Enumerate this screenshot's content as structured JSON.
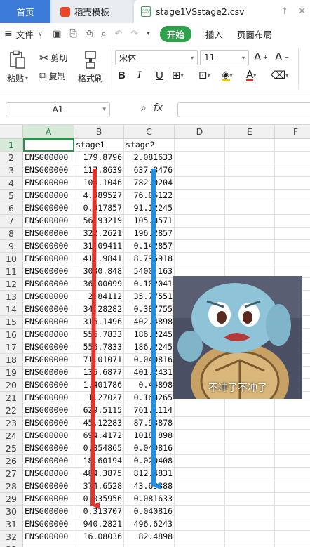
{
  "tabs": [
    {
      "label": "首页"
    },
    {
      "label": "稻壳模板"
    },
    {
      "label": "stage1VSstage2.csv"
    }
  ],
  "menubar": {
    "file_menu": "文件",
    "start": "开始",
    "insert": "插入",
    "page_layout": "页面布局"
  },
  "ribbon": {
    "paste": "粘贴",
    "cut": "剪切",
    "copy": "复制",
    "format_painter": "格式刷",
    "font_name": "宋体",
    "font_size": "11",
    "bold": "B",
    "italic": "I",
    "underline": "U"
  },
  "formula_bar": {
    "name_box": "A1",
    "fx": "fx"
  },
  "grid": {
    "columns": [
      "A",
      "B",
      "C",
      "D",
      "E",
      "F"
    ],
    "rows": [
      {
        "num": "1",
        "a": "",
        "b": "stage1",
        "c": "stage2"
      },
      {
        "num": "2",
        "a": "ENSG00000",
        "b": "179.8796",
        "c": "2.081633"
      },
      {
        "num": "3",
        "a": "ENSG00000",
        "b": "117.8639",
        "c": "637.8476"
      },
      {
        "num": "4",
        "a": "ENSG00000",
        "b": "103.1046",
        "c": "782.0204"
      },
      {
        "num": "5",
        "a": "ENSG00000",
        "b": "4.089527",
        "c": "76.06122"
      },
      {
        "num": "6",
        "a": "ENSG00000",
        "b": "0.017857",
        "c": "91.12245"
      },
      {
        "num": "7",
        "a": "ENSG00000",
        "b": "56.93219",
        "c": "105.8571"
      },
      {
        "num": "8",
        "a": "ENSG00000",
        "b": "322.2621",
        "c": "196.2857"
      },
      {
        "num": "9",
        "a": "ENSG00000",
        "b": "31.09411",
        "c": "0.142857"
      },
      {
        "num": "10",
        "a": "ENSG00000",
        "b": "411.9841",
        "c": "8.795918"
      },
      {
        "num": "11",
        "a": "ENSG00000",
        "b": "3030.848",
        "c": "5400.163"
      },
      {
        "num": "12",
        "a": "ENSG00000",
        "b": "36.00099",
        "c": "0.102041"
      },
      {
        "num": "13",
        "a": "ENSG00000",
        "b": "2.84112",
        "c": "35.77551"
      },
      {
        "num": "14",
        "a": "ENSG00000",
        "b": "34.28282",
        "c": "0.387755"
      },
      {
        "num": "15",
        "a": "ENSG00000",
        "b": "316.1496",
        "c": "402.4898"
      },
      {
        "num": "16",
        "a": "ENSG00000",
        "b": "556.7833",
        "c": "186.2245"
      },
      {
        "num": "17",
        "a": "ENSG00000",
        "b": "556.7833",
        "c": "186.2245"
      },
      {
        "num": "18",
        "a": "ENSG00000",
        "b": "71.01071",
        "c": "0.040816"
      },
      {
        "num": "19",
        "a": "ENSG00000",
        "b": "135.6877",
        "c": "401.2431"
      },
      {
        "num": "20",
        "a": "ENSG00000",
        "b": "1.401786",
        "c": "0.44898"
      },
      {
        "num": "21",
        "a": "ENSG00000",
        "b": "1.27027",
        "c": "0.163265"
      },
      {
        "num": "22",
        "a": "ENSG00000",
        "b": "629.5115",
        "c": "761.1114"
      },
      {
        "num": "23",
        "a": "ENSG00000",
        "b": "45.12283",
        "c": "87.93878"
      },
      {
        "num": "24",
        "a": "ENSG00000",
        "b": "694.4172",
        "c": "1018.898"
      },
      {
        "num": "25",
        "a": "ENSG00000",
        "b": "0.354865",
        "c": "0.040816"
      },
      {
        "num": "26",
        "a": "ENSG00000",
        "b": "18.60194",
        "c": "0.020408"
      },
      {
        "num": "27",
        "a": "ENSG00000",
        "b": "484.3875",
        "c": "812.4831"
      },
      {
        "num": "28",
        "a": "ENSG00000",
        "b": "374.6528",
        "c": "43.69388"
      },
      {
        "num": "29",
        "a": "ENSG00000",
        "b": "0.035956",
        "c": "0.081633"
      },
      {
        "num": "30",
        "a": "ENSG00000",
        "b": "0.313707",
        "c": "0.040816"
      },
      {
        "num": "31",
        "a": "ENSG00000",
        "b": "940.2821",
        "c": "496.6243"
      },
      {
        "num": "32",
        "a": "ENSG00000",
        "b": "16.08036",
        "c": "82.4898"
      },
      {
        "num": "33",
        "a": "",
        "b": "",
        "c": ""
      }
    ]
  },
  "sticker": {
    "caption": "不冲了不冲了"
  },
  "colors": {
    "accent_green": "#2fa14d",
    "home_tab_blue": "#3c7bd8",
    "arrow_red": "#e5322b",
    "arrow_blue": "#1e90e6"
  }
}
